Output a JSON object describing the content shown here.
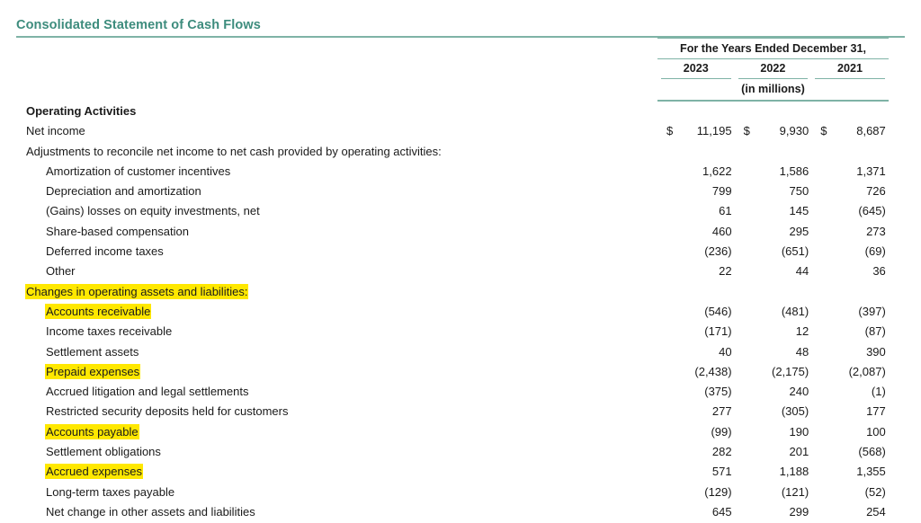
{
  "document": {
    "title": "Consolidated Statement of Cash Flows",
    "accent_color": "#3d8c7d",
    "rule_color": "#7fb3a6",
    "highlight_color": "#ffe800"
  },
  "table": {
    "header": {
      "span_label": "For the Years Ended December 31,",
      "units_label": "(in millions)",
      "years": [
        "2023",
        "2022",
        "2021"
      ]
    },
    "rows": [
      {
        "label": "Operating Activities",
        "indent": 0,
        "bold": true,
        "highlight": false,
        "currency": false,
        "values": [
          "",
          "",
          ""
        ]
      },
      {
        "label": "Net income",
        "indent": 0,
        "bold": false,
        "highlight": false,
        "currency": true,
        "currency_symbol": "$",
        "values": [
          "11,195",
          "9,930",
          "8,687"
        ]
      },
      {
        "label": "Adjustments to reconcile net income to net cash provided by operating activities:",
        "indent": 0,
        "bold": false,
        "highlight": false,
        "currency": false,
        "values": [
          "",
          "",
          ""
        ]
      },
      {
        "label": "Amortization of customer incentives",
        "indent": 1,
        "bold": false,
        "highlight": false,
        "currency": false,
        "values": [
          "1,622",
          "1,586",
          "1,371"
        ]
      },
      {
        "label": "Depreciation and amortization",
        "indent": 1,
        "bold": false,
        "highlight": false,
        "currency": false,
        "values": [
          "799",
          "750",
          "726"
        ]
      },
      {
        "label": "(Gains) losses on equity investments, net",
        "indent": 1,
        "bold": false,
        "highlight": false,
        "currency": false,
        "values": [
          "61",
          "145",
          "(645)"
        ]
      },
      {
        "label": "Share-based compensation",
        "indent": 1,
        "bold": false,
        "highlight": false,
        "currency": false,
        "values": [
          "460",
          "295",
          "273"
        ]
      },
      {
        "label": "Deferred income taxes",
        "indent": 1,
        "bold": false,
        "highlight": false,
        "currency": false,
        "values": [
          "(236)",
          "(651)",
          "(69)"
        ]
      },
      {
        "label": "Other",
        "indent": 1,
        "bold": false,
        "highlight": false,
        "currency": false,
        "values": [
          "22",
          "44",
          "36"
        ]
      },
      {
        "label": "Changes in operating assets and liabilities:",
        "indent": 0,
        "bold": false,
        "highlight": true,
        "currency": false,
        "values": [
          "",
          "",
          ""
        ]
      },
      {
        "label": "Accounts receivable",
        "indent": 1,
        "bold": false,
        "highlight": true,
        "currency": false,
        "values": [
          "(546)",
          "(481)",
          "(397)"
        ]
      },
      {
        "label": "Income taxes receivable",
        "indent": 1,
        "bold": false,
        "highlight": false,
        "currency": false,
        "values": [
          "(171)",
          "12",
          "(87)"
        ]
      },
      {
        "label": "Settlement assets",
        "indent": 1,
        "bold": false,
        "highlight": false,
        "currency": false,
        "values": [
          "40",
          "48",
          "390"
        ]
      },
      {
        "label": "Prepaid expenses",
        "indent": 1,
        "bold": false,
        "highlight": true,
        "currency": false,
        "values": [
          "(2,438)",
          "(2,175)",
          "(2,087)"
        ]
      },
      {
        "label": "Accrued litigation and legal settlements",
        "indent": 1,
        "bold": false,
        "highlight": false,
        "currency": false,
        "values": [
          "(375)",
          "240",
          "(1)"
        ]
      },
      {
        "label": "Restricted security deposits held for customers",
        "indent": 1,
        "bold": false,
        "highlight": false,
        "currency": false,
        "values": [
          "277",
          "(305)",
          "177"
        ]
      },
      {
        "label": "Accounts payable",
        "indent": 1,
        "bold": false,
        "highlight": true,
        "currency": false,
        "values": [
          "(99)",
          "190",
          "100"
        ]
      },
      {
        "label": "Settlement obligations",
        "indent": 1,
        "bold": false,
        "highlight": false,
        "currency": false,
        "values": [
          "282",
          "201",
          "(568)"
        ]
      },
      {
        "label": "Accrued expenses",
        "indent": 1,
        "bold": false,
        "highlight": true,
        "currency": false,
        "values": [
          "571",
          "1,188",
          "1,355"
        ]
      },
      {
        "label": "Long-term taxes payable",
        "indent": 1,
        "bold": false,
        "highlight": false,
        "currency": false,
        "values": [
          "(129)",
          "(121)",
          "(52)"
        ]
      },
      {
        "label": "Net change in other assets and liabilities",
        "indent": 1,
        "bold": false,
        "highlight": false,
        "currency": false,
        "values": [
          "645",
          "299",
          "254"
        ]
      }
    ]
  }
}
